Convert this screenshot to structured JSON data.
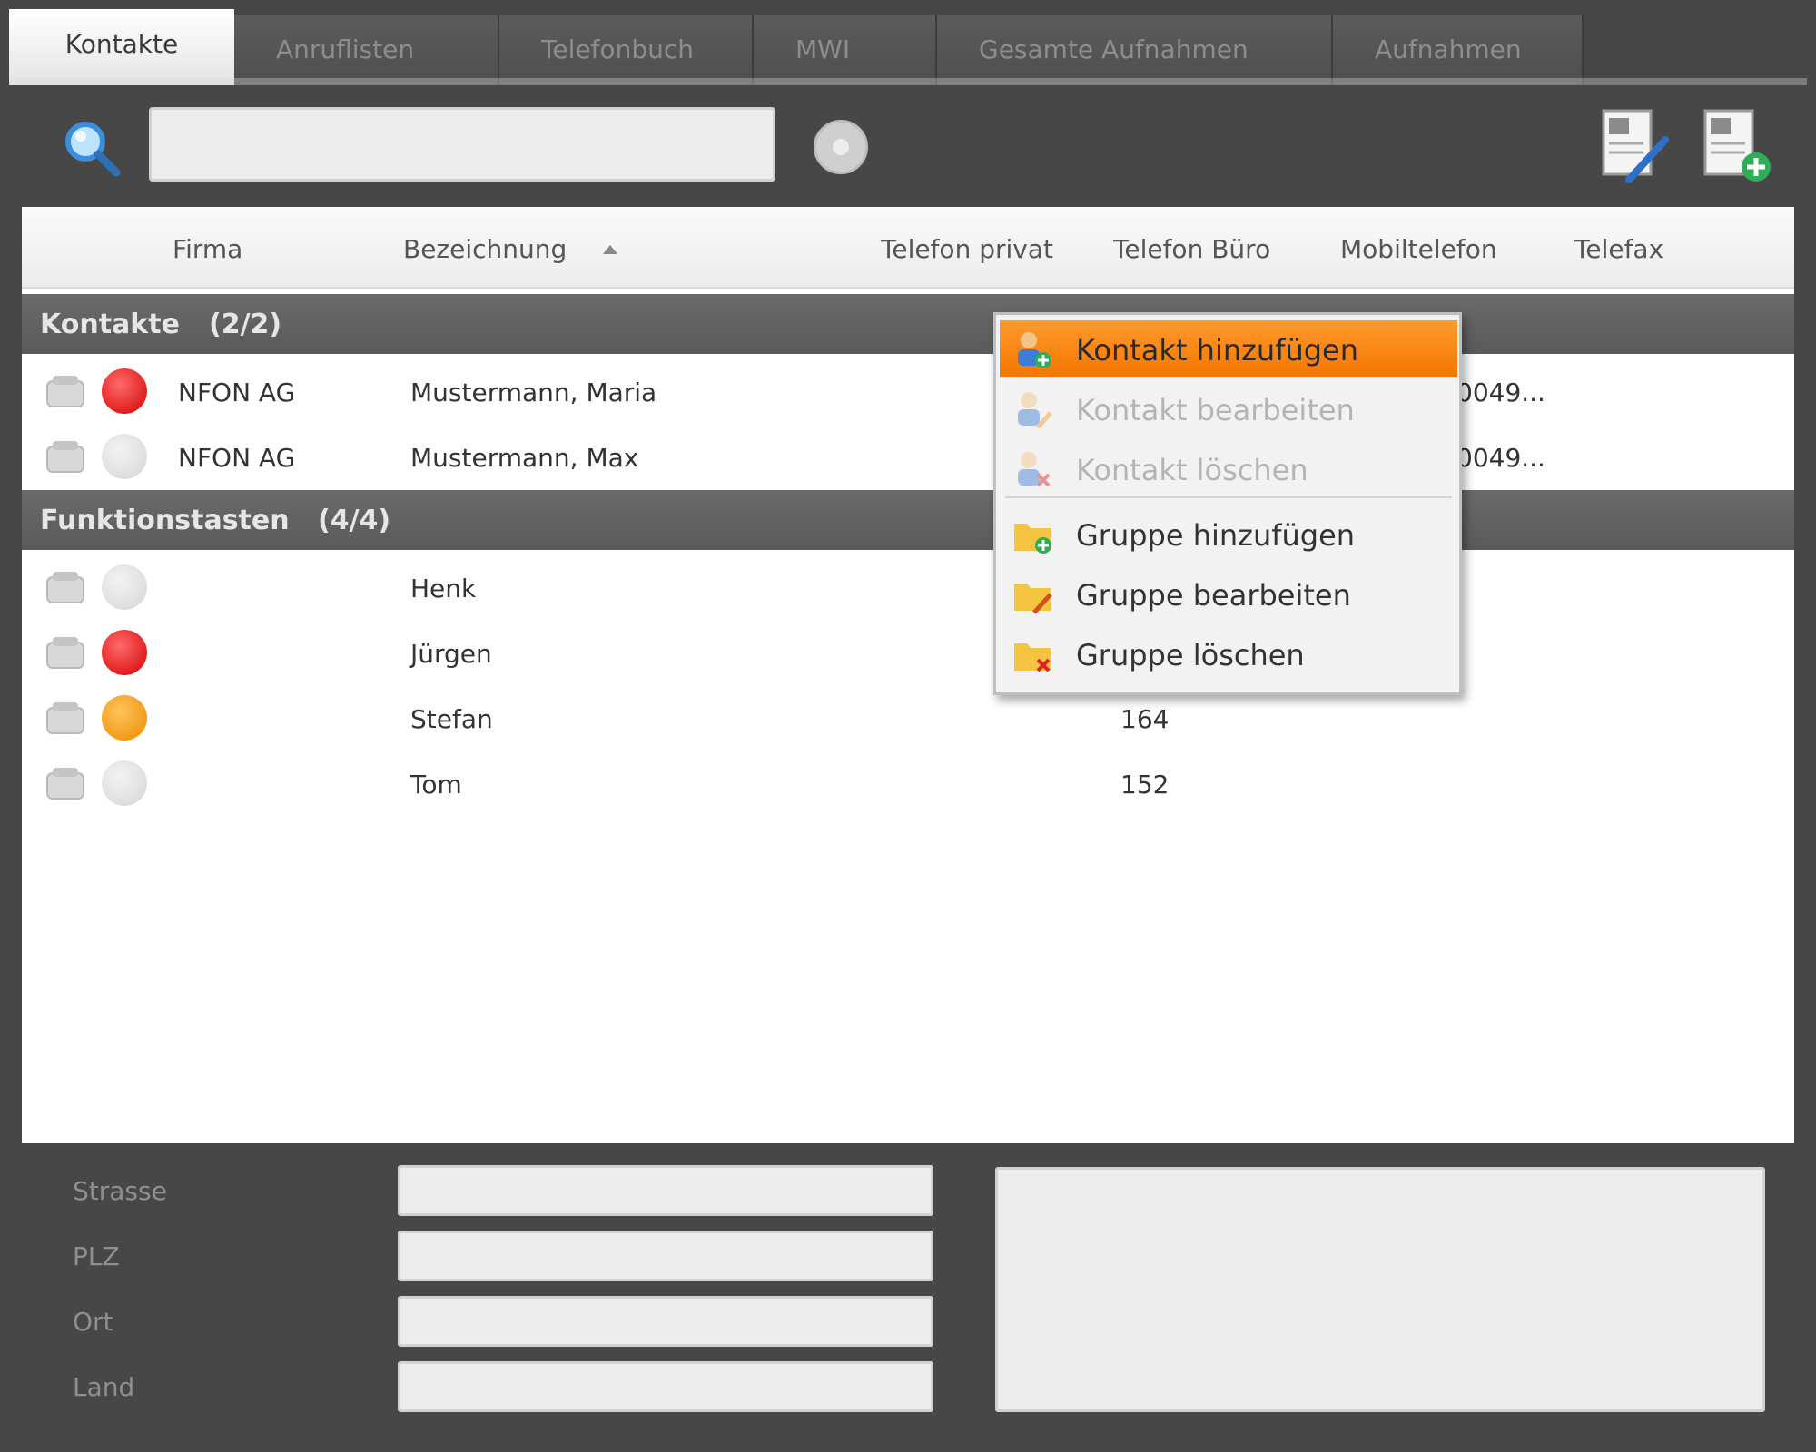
{
  "tabs": [
    {
      "label": "Kontakte",
      "active": true
    },
    {
      "label": "Anruflisten",
      "active": false
    },
    {
      "label": "Telefonbuch",
      "active": false
    },
    {
      "label": "MWI",
      "active": false
    },
    {
      "label": "Gesamte Aufnahmen",
      "active": false
    },
    {
      "label": "Aufnahmen",
      "active": false
    }
  ],
  "toolbar": {
    "search_value": "",
    "search_icon": "search-icon",
    "clear_icon": "clear-icon",
    "edit_icon": "edit-contact-icon",
    "add_icon": "add-addressbook-icon"
  },
  "columns": {
    "firma": "Firma",
    "bezeichnung": "Bezeichnung",
    "telefon_privat": "Telefon privat",
    "telefon_buero": "Telefon Büro",
    "mobiltelefon": "Mobiltelefon",
    "telefax": "Telefax"
  },
  "groups": [
    {
      "name": "Kontakte",
      "count": "(2/2)",
      "rows": [
        {
          "status": "red",
          "firma": "NFON AG",
          "bezeichnung": "Mustermann, Maria",
          "mobil": "0049..."
        },
        {
          "status": "gray",
          "firma": "NFON AG",
          "bezeichnung": "Mustermann, Max",
          "mobil": "0049..."
        }
      ]
    },
    {
      "name": "Funktionstasten",
      "count": "(4/4)",
      "rows": [
        {
          "status": "gray",
          "firma": "",
          "bezeichnung": "Henk",
          "buero": ""
        },
        {
          "status": "red",
          "firma": "",
          "bezeichnung": "Jürgen",
          "buero": ""
        },
        {
          "status": "orange",
          "firma": "",
          "bezeichnung": "Stefan",
          "buero": "164"
        },
        {
          "status": "gray",
          "firma": "",
          "bezeichnung": "Tom",
          "buero": "152"
        }
      ]
    }
  ],
  "context_menu": {
    "items": [
      {
        "label": "Kontakt hinzufügen",
        "icon": "add-contact-icon",
        "state": "highlight"
      },
      {
        "label": "Kontakt bearbeiten",
        "icon": "edit-contact-icon",
        "state": "disabled"
      },
      {
        "label": "Kontakt löschen",
        "icon": "delete-contact-icon",
        "state": "disabled"
      },
      {
        "label": "Gruppe hinzufügen",
        "icon": "add-group-icon",
        "state": "enabled"
      },
      {
        "label": "Gruppe bearbeiten",
        "icon": "edit-group-icon",
        "state": "enabled"
      },
      {
        "label": "Gruppe löschen",
        "icon": "delete-group-icon",
        "state": "enabled"
      }
    ]
  },
  "details": {
    "strasse_label": "Strasse",
    "plz_label": "PLZ",
    "ort_label": "Ort",
    "land_label": "Land",
    "strasse": "",
    "plz": "",
    "ort": "",
    "land": "",
    "notes": ""
  },
  "colors": {
    "highlight": "#f47700",
    "status_red": "#d40000",
    "status_orange": "#ee8a00",
    "group_header": "#5f5f5f"
  }
}
